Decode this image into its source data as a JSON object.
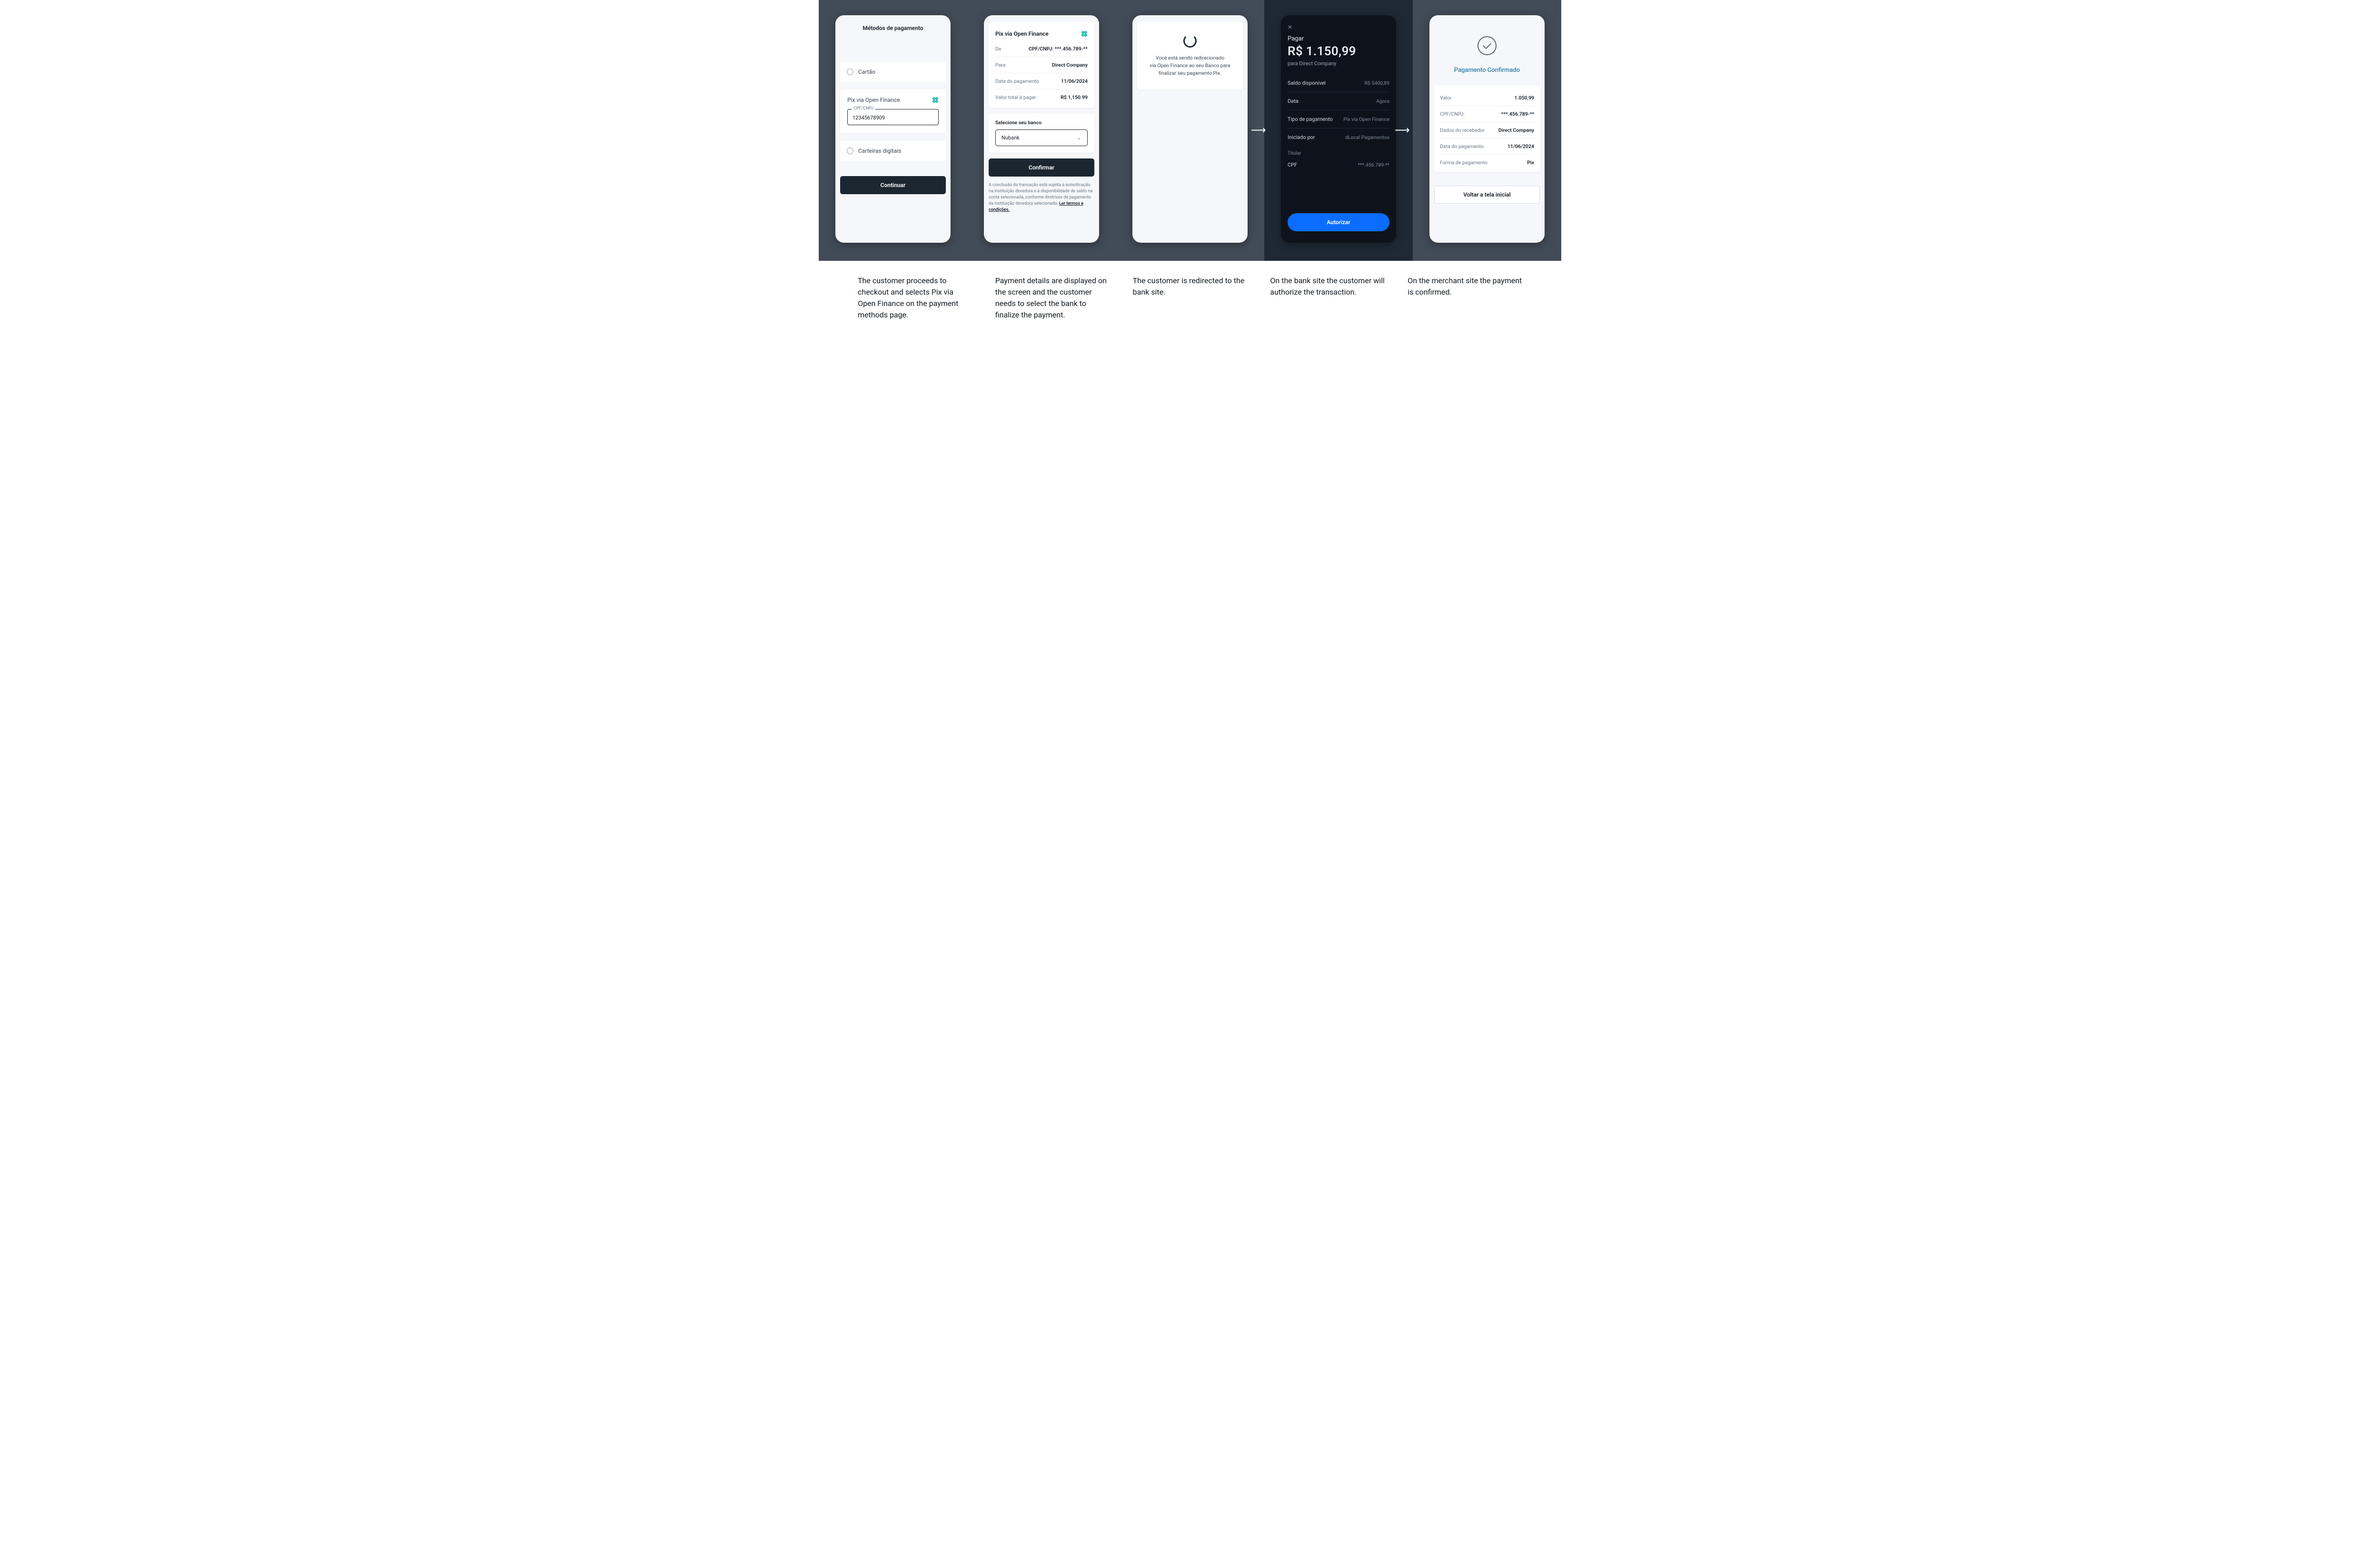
{
  "screen1": {
    "title": "Métodos de pagamento",
    "method_cartao": "Cartão",
    "method_pix": "Pix via Open Finance",
    "method_wallets": "Carteiras digitais",
    "field_label": "CPF/CNPJ",
    "field_value": "12345678909",
    "cta": "Continuar"
  },
  "screen2": {
    "header": "Pix via Open Finance",
    "rows": {
      "de_k": "De",
      "de_v": "CPF/CNPJ: ***.456.789-**",
      "para_k": "Para",
      "para_v": "Direct Company",
      "data_k": "Data do pagamento",
      "data_v": "11/06/2024",
      "total_k": "Valor total à pagar",
      "total_v": "R$ 1,150.99"
    },
    "select_label": "Selecione seu banco",
    "select_value": "Nubank",
    "cta": "Confirmar",
    "fine": "A conclusão da transação está sujeita à autenticação na instituição devedora e à disponibilidade de saldo na conta selecionada, conforme diretrizes de pagamento da instituição devedora selecionada. ",
    "fine_link": "Ler termos e condições."
  },
  "screen3": {
    "l1": "Você está sendo redirecionado",
    "l2": "via Open Finance ao seu Banco para",
    "l3": "finalizar seu pagamento Pix."
  },
  "screen4": {
    "pagar": "Pagar",
    "amount": "R$ 1.150,99",
    "to": "para Direct Company",
    "rows": {
      "saldo_k": "Saldo disponível",
      "saldo_v": "R$ 5400,89",
      "data_k": "Data",
      "data_v": "Agora",
      "tipo_k": "Tipo de pagamento",
      "tipo_v": "Pix via Open Finance",
      "ini_k": "Iniciado por",
      "ini_v": "dLocal Pagamentos"
    },
    "titular_label": "Titular",
    "cpf_k": "CPF",
    "cpf_v": "***.456.789-**",
    "cta": "Autorizar"
  },
  "screen5": {
    "title": "Pagamento Confirmado",
    "rows": {
      "valor_k": "Valor",
      "valor_v": "1.050,99",
      "cpf_k": "CPF/CNPJ:",
      "cpf_v": "***.456.789-**",
      "receb_k": "Dados do recebedor",
      "receb_v": "Direct Company",
      "data_k": "Data do pagamento",
      "data_v": "11/06/2024",
      "forma_k": "Forma de pagamento",
      "forma_v": "Pix"
    },
    "cta": "Voltar a tela inicial"
  },
  "captions": {
    "c1": "The customer proceeds to checkout and selects Pix via Open Finance on the payment methods page.",
    "c2": "Payment details are displayed on the screen and the customer needs to select the bank to finalize the payment.",
    "c3": "The customer is redirected to the bank site.",
    "c4": "On the bank site the customer will authorize the transaction.",
    "c5": "On the merchant site the payment is confirmed."
  }
}
